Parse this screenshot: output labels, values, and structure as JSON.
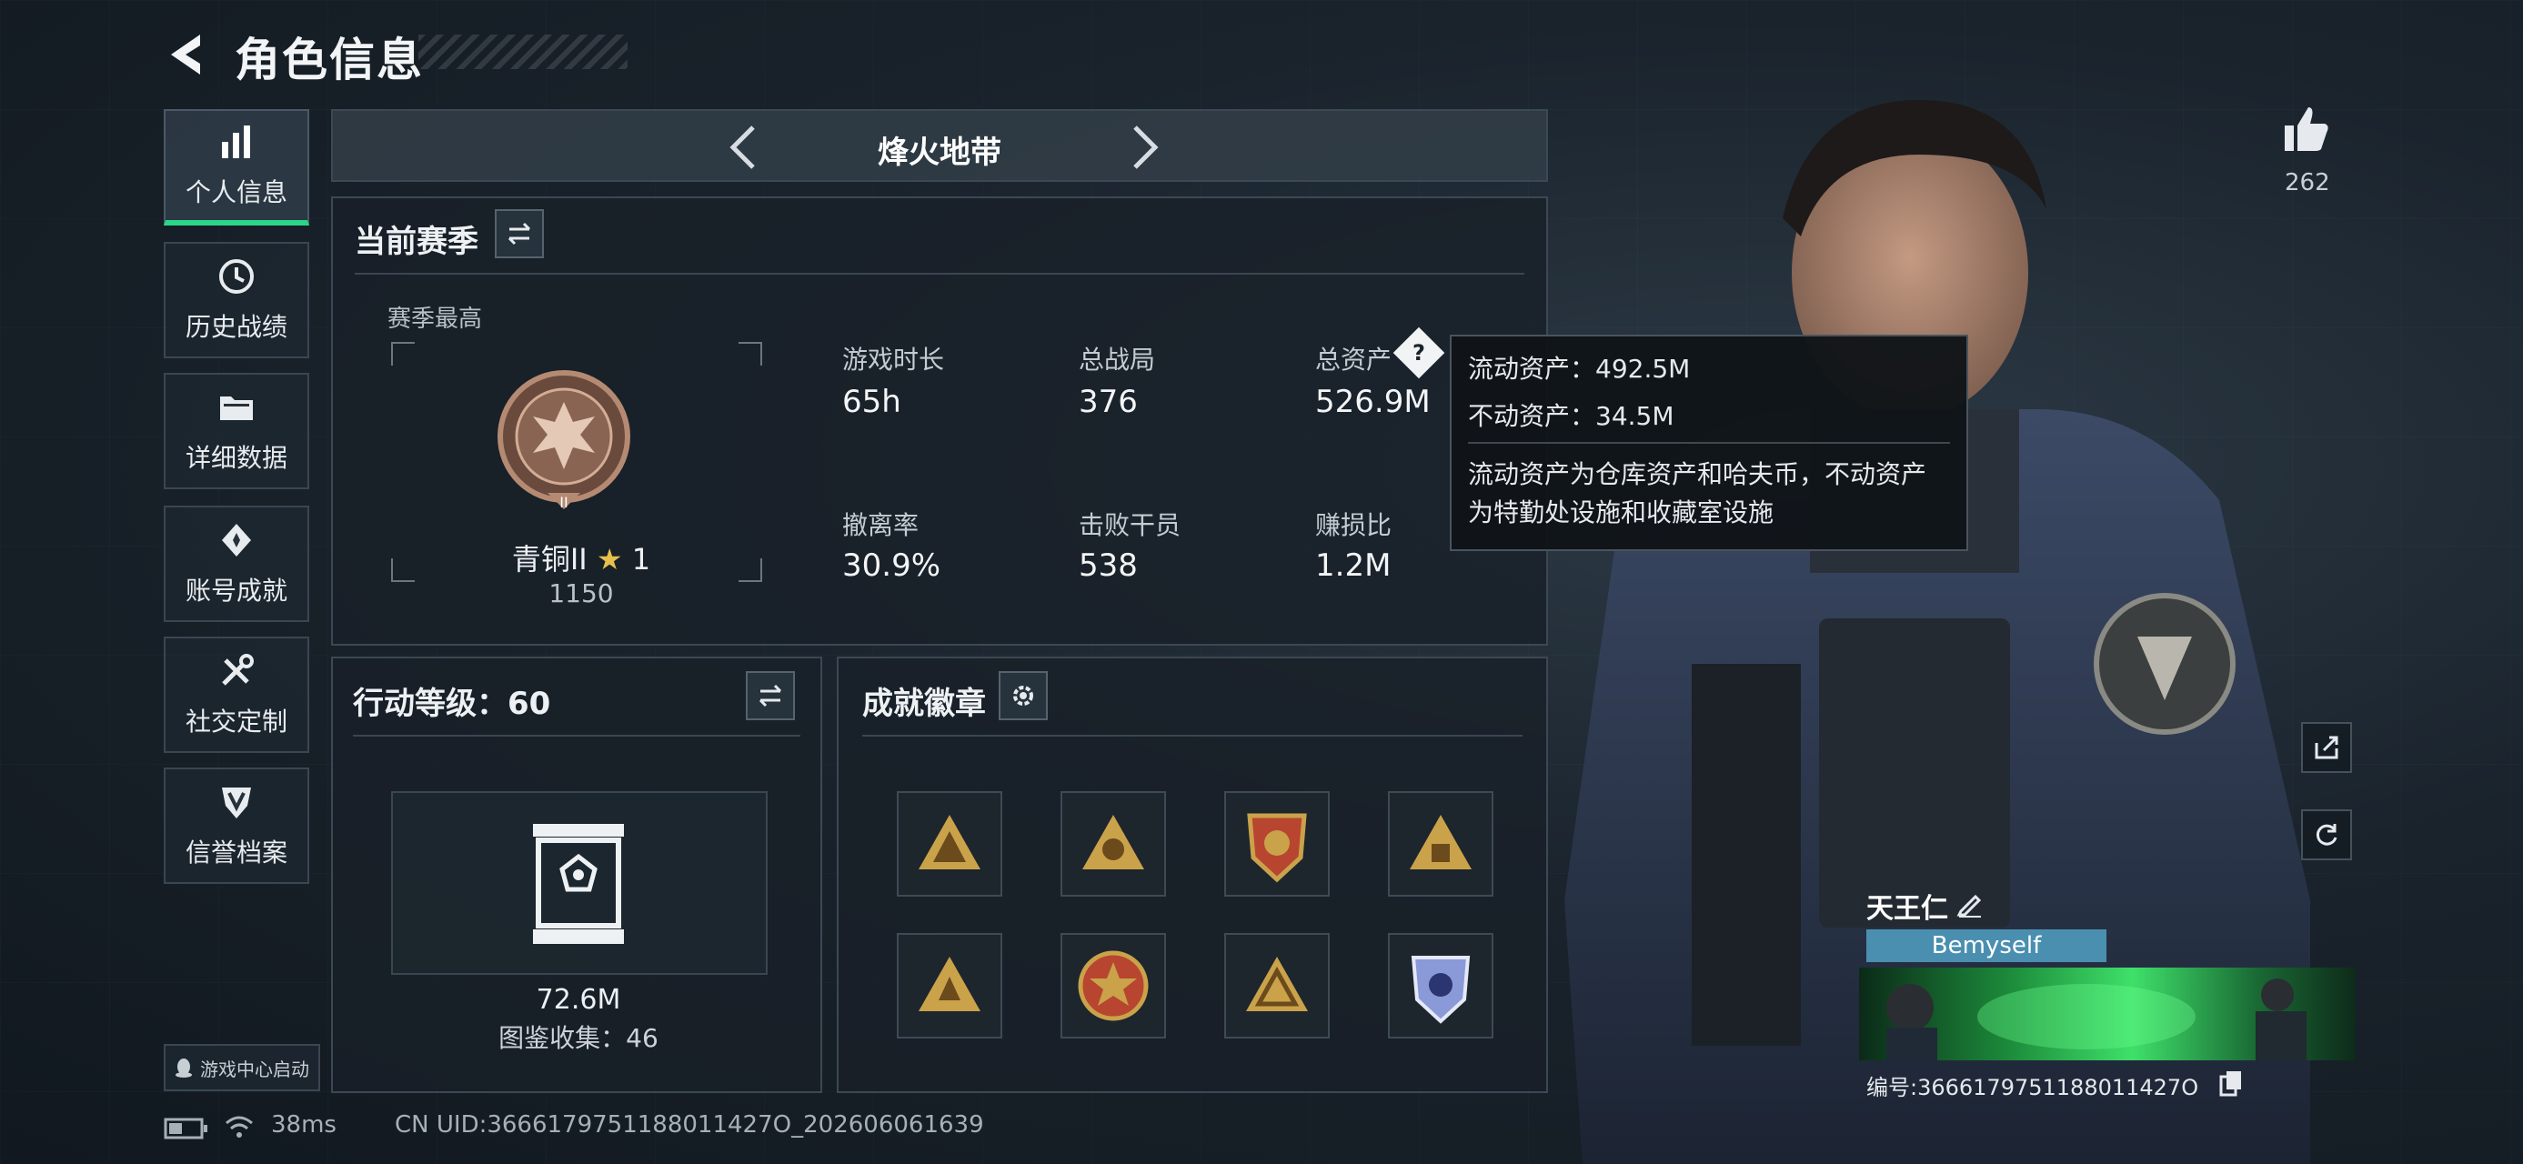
{
  "header": {
    "title": "角色信息"
  },
  "sidebar": {
    "items": [
      {
        "label": "个人信息",
        "icon": "bar-chart-icon",
        "active": true
      },
      {
        "label": "历史战绩",
        "icon": "clock-icon"
      },
      {
        "label": "详细数据",
        "icon": "folder-icon"
      },
      {
        "label": "账号成就",
        "icon": "achievement-icon"
      },
      {
        "label": "社交定制",
        "icon": "tools-icon"
      },
      {
        "label": "信誉档案",
        "icon": "shield-icon"
      }
    ],
    "launch_label": "游戏中心启动"
  },
  "mode": {
    "name": "烽火地带"
  },
  "season": {
    "title": "当前赛季",
    "highest_label": "赛季最高",
    "rank_name": "青铜II",
    "rank_stars": "1",
    "rank_score": "1150",
    "stats": [
      {
        "label": "游戏时长",
        "value": "65h"
      },
      {
        "label": "总战局",
        "value": "376"
      },
      {
        "label": "总资产",
        "value": "526.9M"
      },
      {
        "label": "撤离率",
        "value": "30.9%"
      },
      {
        "label": "击败干员",
        "value": "538"
      },
      {
        "label": "赚损比",
        "value": "1.2M"
      }
    ]
  },
  "tooltip": {
    "liquid": "流动资产：492.5M",
    "fixed": "不动资产：34.5M",
    "desc1": "流动资产为仓库资产和哈夫币，不动资产",
    "desc2": "为特勤处设施和收藏室设施"
  },
  "level": {
    "title": "行动等级：60",
    "value": "72.6M",
    "collection": "图鉴收集：46"
  },
  "badges": {
    "title": "成就徽章",
    "colors": [
      "#c9a24a",
      "#c9a24a",
      "#b8452f",
      "#c9a24a",
      "#c9a24a",
      "#b8452f",
      "#c9a24a",
      "#8a9ad8"
    ]
  },
  "status": {
    "ping": "38ms",
    "uid": "CN UID:3666179751188011427O_202606061639"
  },
  "profile": {
    "likes": "262",
    "name": "天王仁",
    "tag": "Bemyself",
    "id": "编号:3666179751188011427O"
  },
  "colors": {
    "accent": "#29d68a",
    "tag": "#4a8fb0"
  }
}
